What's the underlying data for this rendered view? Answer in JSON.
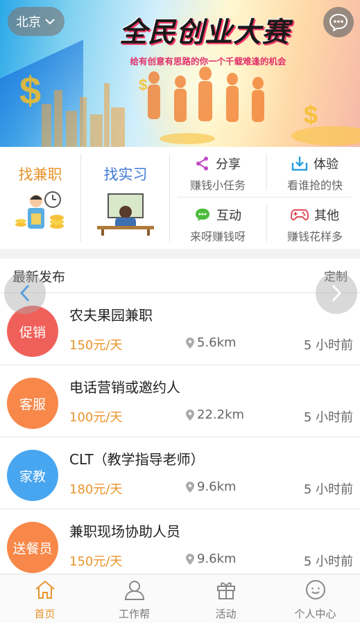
{
  "header": {
    "city": "北京",
    "banner_title": "全民创业大赛",
    "banner_subtitle": "给有创意有思路的你一个千载难逢的机会",
    "icons": {
      "city_dropdown": "chevron-down-icon",
      "message": "chat-bubble-icon"
    }
  },
  "categories": {
    "big": [
      {
        "label": "找兼职",
        "color": "#e8942c"
      },
      {
        "label": "找实习",
        "color": "#3f7bd6"
      }
    ],
    "small": [
      {
        "title": "分享",
        "subtitle": "赚钱小任务",
        "icon": "share-icon",
        "color": "#c04cc6"
      },
      {
        "title": "体验",
        "subtitle": "看谁抢的快",
        "icon": "download-icon",
        "color": "#2a9fe0"
      },
      {
        "title": "互动",
        "subtitle": "来呀赚钱呀",
        "icon": "chat-icon",
        "color": "#4cbb3c"
      },
      {
        "title": "其他",
        "subtitle": "赚钱花样多",
        "icon": "gamepad-icon",
        "color": "#e04b5a"
      }
    ]
  },
  "list": {
    "title": "最新发布",
    "customize": "定制",
    "items": [
      {
        "badge": "促销",
        "badge_color": "#f0605a",
        "title": "农夫果园兼职",
        "pay": "150元/天",
        "distance": "5.6km",
        "time": "5 小时前"
      },
      {
        "badge": "客服",
        "badge_color": "#f7884a",
        "title": "电话营销或邀约人",
        "pay": "100元/天",
        "distance": "22.2km",
        "time": "5 小时前"
      },
      {
        "badge": "家教",
        "badge_color": "#48a6f0",
        "title": "CLT（教学指导老师）",
        "pay": "180元/天",
        "distance": "9.6km",
        "time": "5 小时前"
      },
      {
        "badge": "送餐员",
        "badge_color": "#f7884a",
        "title": "兼职现场协助人员",
        "pay": "150元/天",
        "distance": "9.6km",
        "time": "5 小时前"
      }
    ]
  },
  "tabbar": {
    "active_color": "#e8942c",
    "tabs": [
      {
        "label": "首页",
        "icon": "home-icon",
        "active": true
      },
      {
        "label": "工作帮",
        "icon": "user-icon",
        "active": false
      },
      {
        "label": "活动",
        "icon": "gift-icon",
        "active": false
      },
      {
        "label": "个人中心",
        "icon": "smile-face-icon",
        "active": false
      }
    ]
  }
}
